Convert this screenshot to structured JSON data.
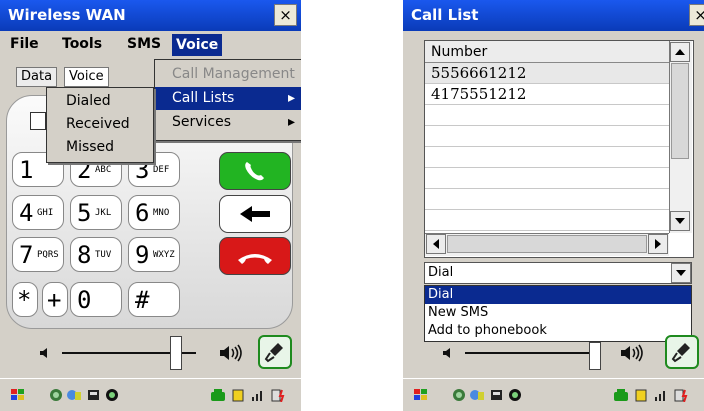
{
  "left": {
    "title": "Wireless WAN",
    "close_label": "×",
    "menu": {
      "file": "File",
      "tools": "Tools",
      "sms": "SMS",
      "voice": "Voice"
    },
    "tabs": {
      "data": "Data",
      "voice": "Voice"
    },
    "submenu": [
      "Call Management",
      "Call Lists",
      "Services"
    ],
    "calllists_menu": [
      "Dialed",
      "Received",
      "Missed"
    ],
    "keys": [
      {
        "digit": "1",
        "letters": ""
      },
      {
        "digit": "2",
        "letters": "ABC"
      },
      {
        "digit": "3",
        "letters": "DEF"
      },
      {
        "digit": "4",
        "letters": "GHI"
      },
      {
        "digit": "5",
        "letters": "JKL"
      },
      {
        "digit": "6",
        "letters": "MNO"
      },
      {
        "digit": "7",
        "letters": "PQRS"
      },
      {
        "digit": "8",
        "letters": "TUV"
      },
      {
        "digit": "9",
        "letters": "WXYZ"
      },
      {
        "digit": "*",
        "letters": ""
      },
      {
        "digit": "+",
        "letters": ""
      },
      {
        "digit": "0",
        "letters": ""
      },
      {
        "digit": "#",
        "letters": ""
      }
    ],
    "volume_level": 0.85,
    "colors": {
      "titlebar": "#1a58ee",
      "call": "#22b422",
      "hangup": "#d81818",
      "highlight": "#0a2a90"
    }
  },
  "right": {
    "title": "Call List",
    "close_label": "×",
    "column_header": "Number",
    "rows": [
      "5556661212",
      "4175551212",
      "",
      "",
      "",
      "",
      "",
      ""
    ],
    "action_selected": "Dial",
    "action_options": [
      "Dial",
      "New SMS",
      "Add to phonebook"
    ]
  }
}
